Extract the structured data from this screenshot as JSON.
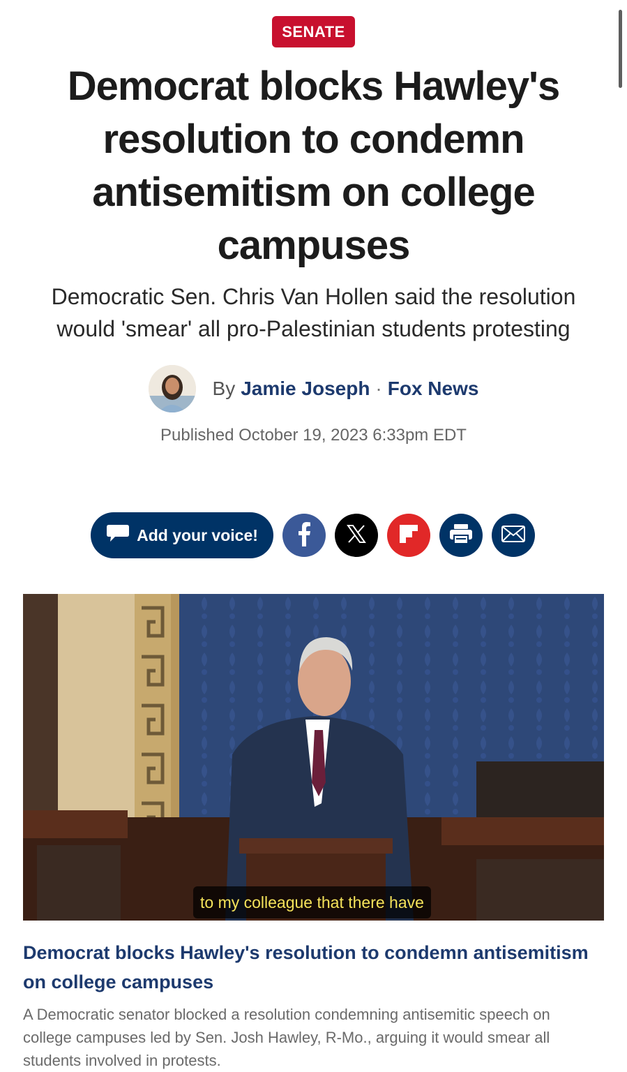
{
  "category": "SENATE",
  "headline": "Democrat blocks Hawley's resolution to condemn antisemitism on college campuses",
  "subheadline": "Democratic Sen. Chris Van Hollen said the resolution would 'smear' all pro-Palestinian students protesting",
  "byline": {
    "by": "By",
    "author": "Jamie Joseph",
    "separator": "·",
    "source": "Fox News"
  },
  "published": "Published October 19, 2023 6:33pm EDT",
  "share": {
    "voice_label": "Add your voice!",
    "icons": [
      "speech-bubble-icon",
      "facebook-icon",
      "x-icon",
      "flipboard-icon",
      "print-icon",
      "email-icon"
    ],
    "colors": {
      "navy": "#003366",
      "facebook": "#3b5998",
      "x": "#000000",
      "flipboard": "#e12828"
    }
  },
  "video": {
    "caption": "to my colleague that there have",
    "title": "Democrat blocks Hawley's resolution to condemn antisemitism on college campuses",
    "description": "A Democratic senator blocked a resolution condemning antisemitic speech on college campuses led by Sen. Josh Hawley, R-Mo., arguing it would smear all students involved in protests."
  },
  "colors": {
    "badge": "#c8102e",
    "link": "#1d3a6e"
  }
}
